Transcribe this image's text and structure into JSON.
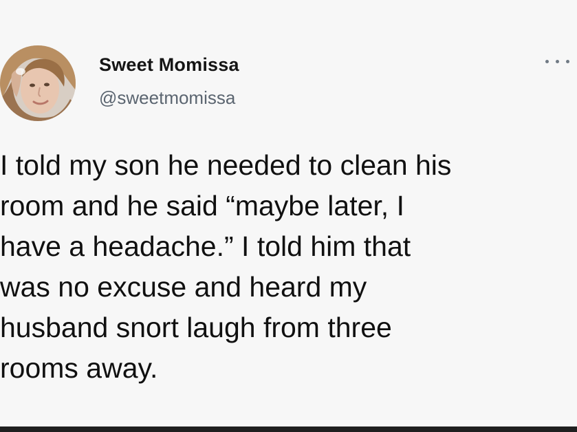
{
  "author": {
    "display_name": "Sweet Momissa",
    "handle": "@sweetmomissa",
    "avatar_icon": "profile-photo"
  },
  "menu": {
    "icon": "more-horizontal-icon"
  },
  "tweet": {
    "lines": [
      "I told my son he needed to clean his",
      "room and he said “maybe later, I",
      "have a headache.” I told him that",
      "was no excuse and heard my",
      "husband snort laugh from three",
      "rooms away."
    ]
  },
  "colors": {
    "background": "#f7f7f7",
    "text": "#101010",
    "secondary_text": "#5b6570"
  }
}
